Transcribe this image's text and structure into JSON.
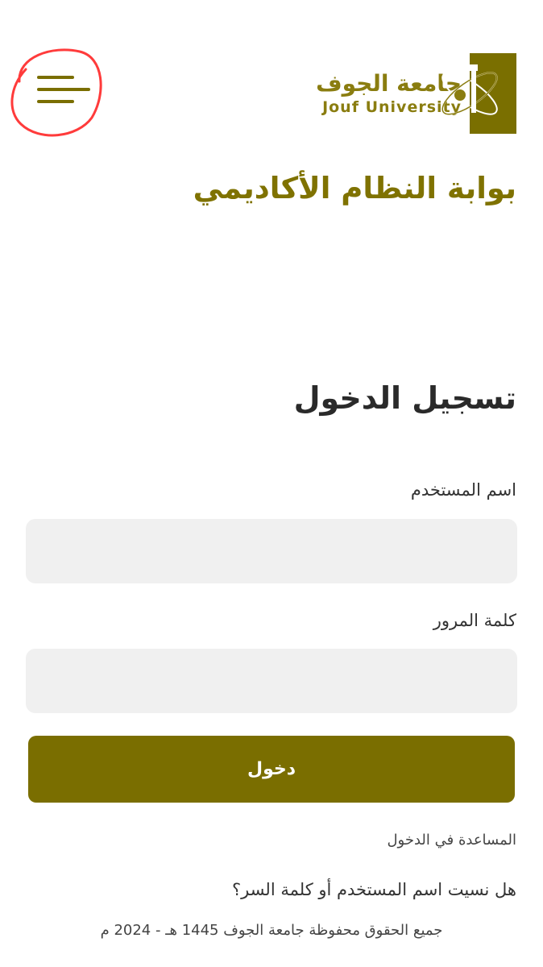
{
  "header": {
    "logo_arabic": "جامعة الجوف",
    "logo_english": "Jouf University",
    "menu_icon": "hamburger-menu-icon",
    "accent_color": "#7a6e00"
  },
  "portal_title": "بوابة النظام الأكاديمي",
  "login": {
    "title": "تسجيل الدخول",
    "username_label": "اسم المستخدم",
    "username_value": "",
    "password_label": "كلمة المرور",
    "password_value": "",
    "submit_label": "دخول"
  },
  "links": {
    "help": "المساعدة في الدخول",
    "forgot": "هل نسيت اسم المستخدم أو كلمة السر؟"
  },
  "footer": {
    "copyright": "جميع الحقوق محفوظة جامعة الجوف 1445 هـ - 2024 م"
  }
}
